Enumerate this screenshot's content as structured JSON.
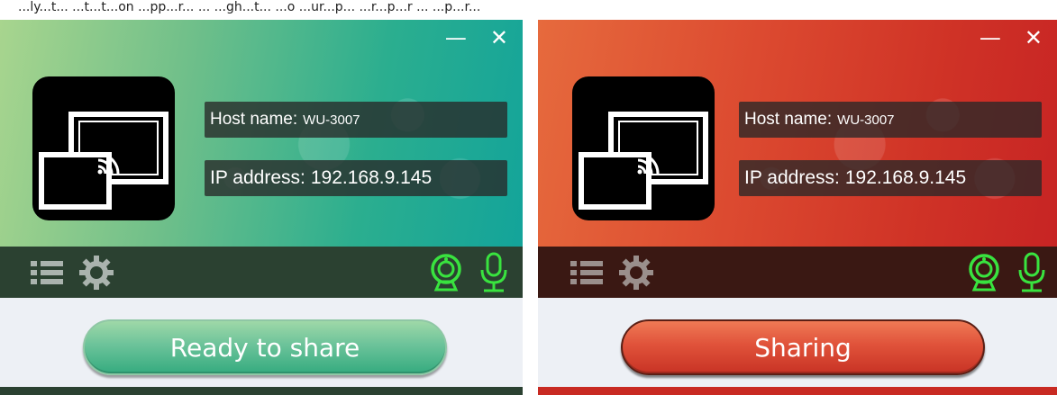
{
  "caption": "...ly...t... ...t...t...on ...pp...r... ... ...gh...t... ...o ...ur...p... ...r...p...r ... ...p...r...",
  "window_controls": {
    "minimize": "—",
    "close": "✕"
  },
  "panels": [
    {
      "state": "ready",
      "host_label": "Host name:",
      "host_value": "WU-3007",
      "ip_label": "IP address:",
      "ip_value": "192.168.9.145",
      "button_label": "Ready to share",
      "accent": "#2bae8f",
      "icon_color": "#39e33f"
    },
    {
      "state": "sharing",
      "host_label": "Host name:",
      "host_value": "WU-3007",
      "ip_label": "IP address:",
      "ip_value": "192.168.9.145",
      "button_label": "Sharing",
      "accent": "#dc4a30",
      "icon_color": "#39e33f"
    }
  ],
  "icons": [
    "list-icon",
    "gear-icon",
    "webcam-icon",
    "microphone-icon",
    "cast-screen-icon"
  ]
}
